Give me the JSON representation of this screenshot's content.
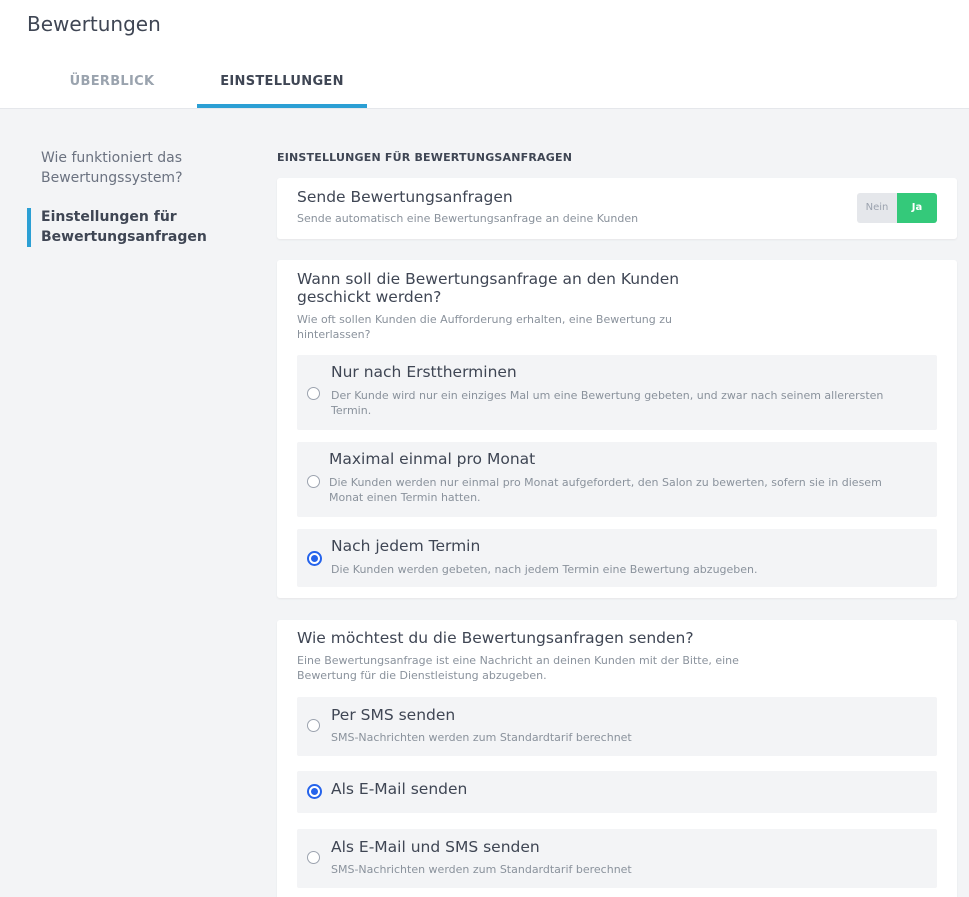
{
  "header": {
    "title": "Bewertungen",
    "tabs": [
      {
        "label": "ÜBERBLICK",
        "active": false
      },
      {
        "label": "EINSTELLUNGEN",
        "active": true
      }
    ]
  },
  "sidebar": {
    "items": [
      {
        "label": "Wie funktioniert das Bewertungssystem?",
        "active": false
      },
      {
        "label": "Einstellungen für Bewertungsanfragen",
        "active": true
      }
    ]
  },
  "main": {
    "section_heading": "EINSTELLUNGEN FÜR BEWERTUNGSANFRAGEN",
    "send_requests": {
      "title": "Sende Bewertungsanfragen",
      "subtitle": "Sende automatisch eine Bewertungsanfrage an deine Kunden",
      "toggle_no": "Nein",
      "toggle_yes": "Ja",
      "value": "Ja"
    },
    "frequency": {
      "title": "Wann soll die Bewertungsanfrage an den Kunden geschickt werden?",
      "subtitle": "Wie oft sollen Kunden die Aufforderung erhalten, eine Bewertung zu hinterlassen?",
      "selected": "Nach jedem Termin",
      "options": [
        {
          "title": "Nur nach Ersttherminen",
          "desc": "Der Kunde wird nur ein einziges Mal um eine Bewertung gebeten, und zwar nach seinem allerersten Termin."
        },
        {
          "title": "Maximal einmal pro Monat",
          "desc": "Die Kunden werden nur einmal pro Monat aufgefordert, den Salon zu bewerten, sofern sie in diesem Monat einen Termin hatten."
        },
        {
          "title": "Nach jedem Termin",
          "desc": "Die Kunden werden gebeten, nach jedem Termin eine Bewertung abzugeben."
        }
      ]
    },
    "channel": {
      "title": "Wie möchtest du die Bewertungsanfragen senden?",
      "subtitle": "Eine Bewertungsanfrage ist eine Nachricht an deinen Kunden mit der Bitte, eine Bewertung für die Dienstleistung abzugeben.",
      "selected": "Als E-Mail senden",
      "options": [
        {
          "title": "Per SMS senden",
          "desc": "SMS-Nachrichten werden zum Standardtarif berechnet"
        },
        {
          "title": "Als E-Mail senden",
          "desc": ""
        },
        {
          "title": "Als E-Mail und SMS senden",
          "desc": "SMS-Nachrichten werden zum Standardtarif berechnet"
        }
      ]
    }
  },
  "colors": {
    "accent": "#2b9fd4",
    "toggle_on": "#34c97a",
    "radio_selected": "#2563eb"
  }
}
